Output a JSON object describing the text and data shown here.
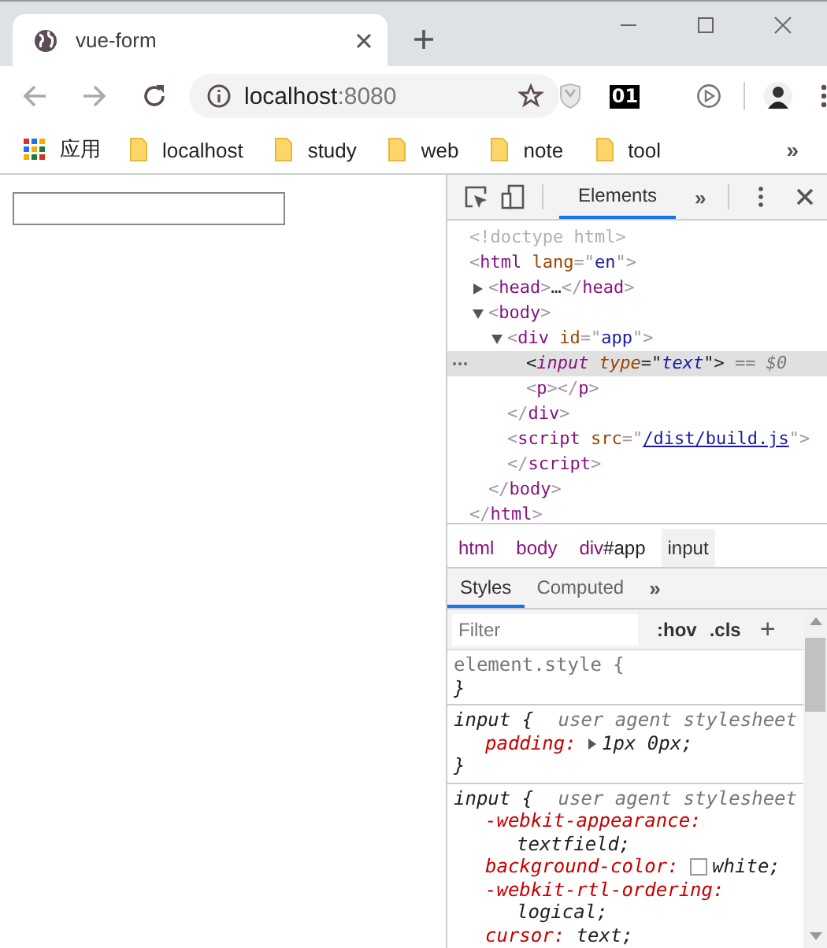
{
  "browser": {
    "tabs": [
      {
        "title": "vue-form",
        "selected": true
      }
    ],
    "address": {
      "host": "localhost",
      "port": ":8080"
    },
    "extension_badge": "01",
    "bookmarks": {
      "apps_label": "应用",
      "folders": [
        "localhost",
        "study",
        "web",
        "note",
        "tool"
      ],
      "overflow": "»"
    }
  },
  "devtools": {
    "tabs": [
      {
        "label": "Elements",
        "selected": true
      }
    ],
    "more_tabs": "»",
    "dom": [
      {
        "selected": false,
        "tokens": [
          {
            "kind": "doctype",
            "text": "<!doctype html>"
          }
        ]
      },
      {
        "selected": false,
        "tokens": [
          {
            "kind": "punct",
            "text": "<"
          },
          {
            "kind": "tag",
            "text": "html"
          },
          {
            "kind": "attr",
            "text": " lang"
          },
          {
            "kind": "punct",
            "text": "=\""
          },
          {
            "kind": "value",
            "text": "en"
          },
          {
            "kind": "punct",
            "text": "\">"
          }
        ],
        "closing": [
          {
            "kind": "punct",
            "text": "</"
          },
          {
            "kind": "tag",
            "text": "html"
          },
          {
            "kind": "punct",
            "text": ">"
          }
        ],
        "children": [
          {
            "selected": false,
            "expanded": false,
            "tokens": [
              {
                "kind": "punct",
                "text": "<"
              },
              {
                "kind": "tag",
                "text": "head"
              },
              {
                "kind": "punct",
                "text": ">"
              },
              {
                "kind": "ellipsis",
                "text": "…"
              },
              {
                "kind": "punct",
                "text": "</"
              },
              {
                "kind": "tag",
                "text": "head"
              },
              {
                "kind": "punct",
                "text": ">"
              }
            ]
          },
          {
            "selected": false,
            "expanded": true,
            "tokens": [
              {
                "kind": "punct",
                "text": "<"
              },
              {
                "kind": "tag",
                "text": "body"
              },
              {
                "kind": "punct",
                "text": ">"
              }
            ],
            "closing": [
              {
                "kind": "punct",
                "text": "</"
              },
              {
                "kind": "tag",
                "text": "body"
              },
              {
                "kind": "punct",
                "text": ">"
              }
            ],
            "children": [
              {
                "selected": false,
                "expanded": true,
                "tokens": [
                  {
                    "kind": "punct",
                    "text": "<"
                  },
                  {
                    "kind": "tag",
                    "text": "div"
                  },
                  {
                    "kind": "attr",
                    "text": " id"
                  },
                  {
                    "kind": "punct",
                    "text": "=\""
                  },
                  {
                    "kind": "value",
                    "text": "app"
                  },
                  {
                    "kind": "punct",
                    "text": "\">"
                  }
                ],
                "closing": [
                  {
                    "kind": "punct",
                    "text": "</"
                  },
                  {
                    "kind": "tag",
                    "text": "div"
                  },
                  {
                    "kind": "punct",
                    "text": ">"
                  }
                ],
                "children": [
                  {
                    "selected": true,
                    "tokens": [
                      {
                        "kind": "punct",
                        "text": "<"
                      },
                      {
                        "kind": "tag",
                        "text": "input"
                      },
                      {
                        "kind": "attr",
                        "text": " type"
                      },
                      {
                        "kind": "punct",
                        "text": "=\""
                      },
                      {
                        "kind": "value",
                        "text": "text"
                      },
                      {
                        "kind": "punct",
                        "text": "\">"
                      },
                      {
                        "kind": "marker",
                        "text": " == $0"
                      }
                    ]
                  },
                  {
                    "selected": false,
                    "tokens": [
                      {
                        "kind": "punct",
                        "text": "<"
                      },
                      {
                        "kind": "tag",
                        "text": "p"
                      },
                      {
                        "kind": "punct",
                        "text": "></"
                      },
                      {
                        "kind": "tag",
                        "text": "p"
                      },
                      {
                        "kind": "punct",
                        "text": ">"
                      }
                    ]
                  }
                ]
              },
              {
                "selected": false,
                "tokens": [
                  {
                    "kind": "punct",
                    "text": "<"
                  },
                  {
                    "kind": "tag",
                    "text": "script"
                  },
                  {
                    "kind": "attr",
                    "text": " src"
                  },
                  {
                    "kind": "punct",
                    "text": "=\""
                  },
                  {
                    "kind": "link",
                    "text": "/dist/build.js"
                  },
                  {
                    "kind": "punct",
                    "text": "\">"
                  }
                ],
                "closing": [
                  {
                    "kind": "punct",
                    "text": "</"
                  },
                  {
                    "kind": "tag",
                    "text": "script"
                  },
                  {
                    "kind": "punct",
                    "text": ">"
                  }
                ]
              }
            ]
          }
        ]
      }
    ],
    "breadcrumbs": [
      {
        "name": "html",
        "selected": false
      },
      {
        "name": "body",
        "selected": false
      },
      {
        "name": "div",
        "suffix": "#app",
        "selected": false
      },
      {
        "name": "input",
        "selected": true
      }
    ],
    "style_tabs": [
      {
        "label": "Styles",
        "selected": true
      },
      {
        "label": "Computed",
        "selected": false
      }
    ],
    "style_more": "»",
    "filter": {
      "placeholder": "Filter"
    },
    "filter_buttons": [
      ":hov",
      ".cls"
    ],
    "add_rule": "+",
    "rules": [
      {
        "kind": "inline",
        "selector": "element.style {",
        "close": "}"
      },
      {
        "kind": "user_agent",
        "selector": "input {",
        "origin": "user agent stylesheet",
        "close": "}",
        "declarations": [
          {
            "property": "padding:",
            "value": "1px 0px;",
            "expandable": true
          }
        ]
      },
      {
        "kind": "user_agent",
        "selector": "input {",
        "origin": "user agent stylesheet",
        "declarations": [
          {
            "property": "-webkit-appearance:",
            "value": "textfield;"
          },
          {
            "property": "background-color:",
            "value": "white;",
            "color": "#ffffff"
          },
          {
            "property": "-webkit-rtl-ordering:",
            "value": "logical;"
          },
          {
            "property": "cursor:",
            "value": "text;"
          }
        ]
      }
    ]
  }
}
